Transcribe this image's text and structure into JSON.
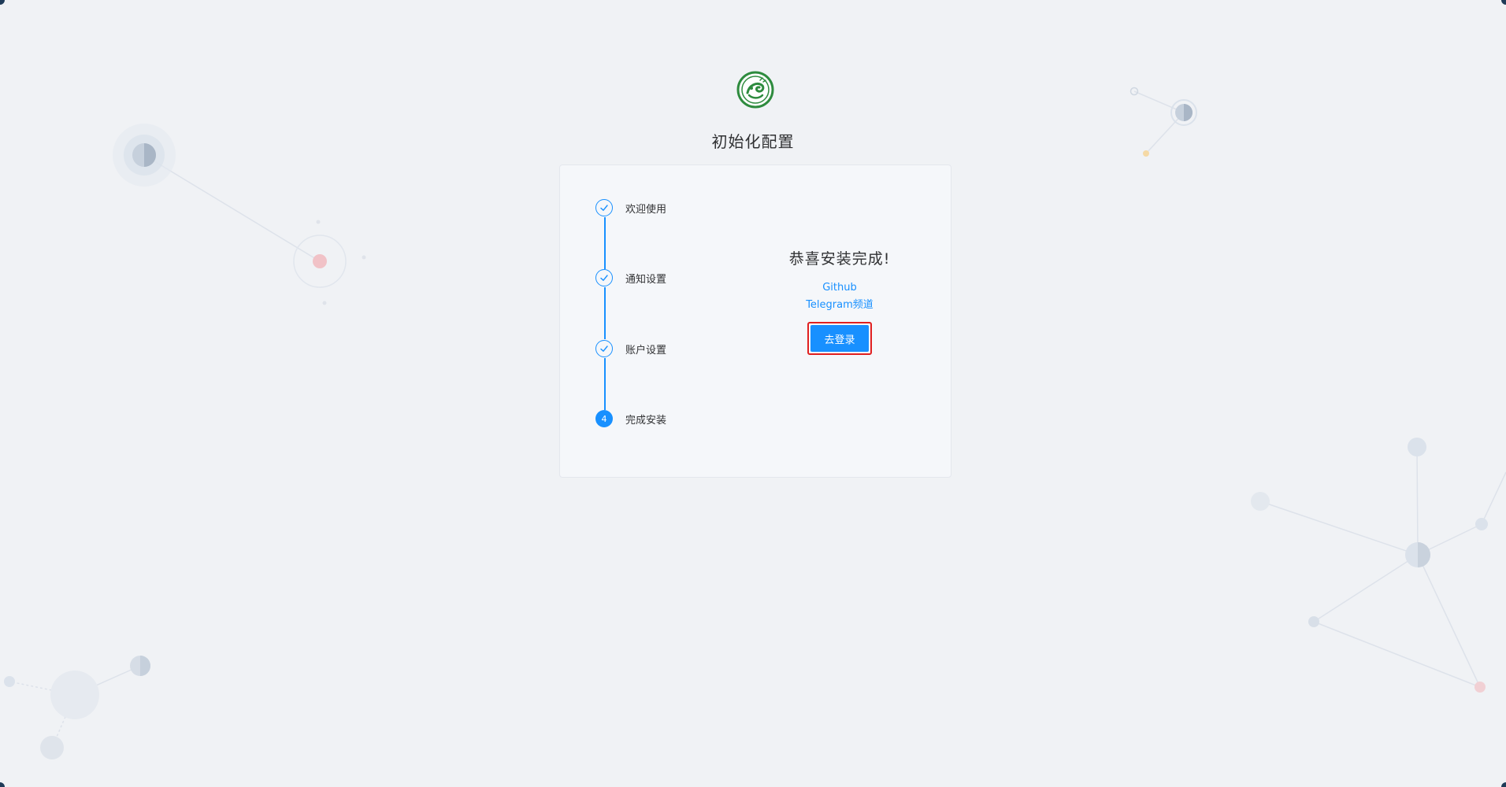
{
  "page": {
    "title": "初始化配置",
    "logo_icon": "dragon-emblem-icon"
  },
  "steps": [
    {
      "label": "欢迎使用",
      "state": "done",
      "icon": "check-icon"
    },
    {
      "label": "通知设置",
      "state": "done",
      "icon": "check-icon"
    },
    {
      "label": "账户设置",
      "state": "done",
      "icon": "check-icon"
    },
    {
      "label": "完成安装",
      "state": "active",
      "number": "4"
    }
  ],
  "result": {
    "title": "恭喜安装完成!",
    "links": [
      {
        "label": "Github"
      },
      {
        "label": "Telegram频道"
      }
    ],
    "login_button": "去登录"
  },
  "colors": {
    "accent": "#1890ff",
    "background": "#f0f2f5",
    "highlight_border": "#e02020",
    "logo_green": "#2e8b3e"
  }
}
